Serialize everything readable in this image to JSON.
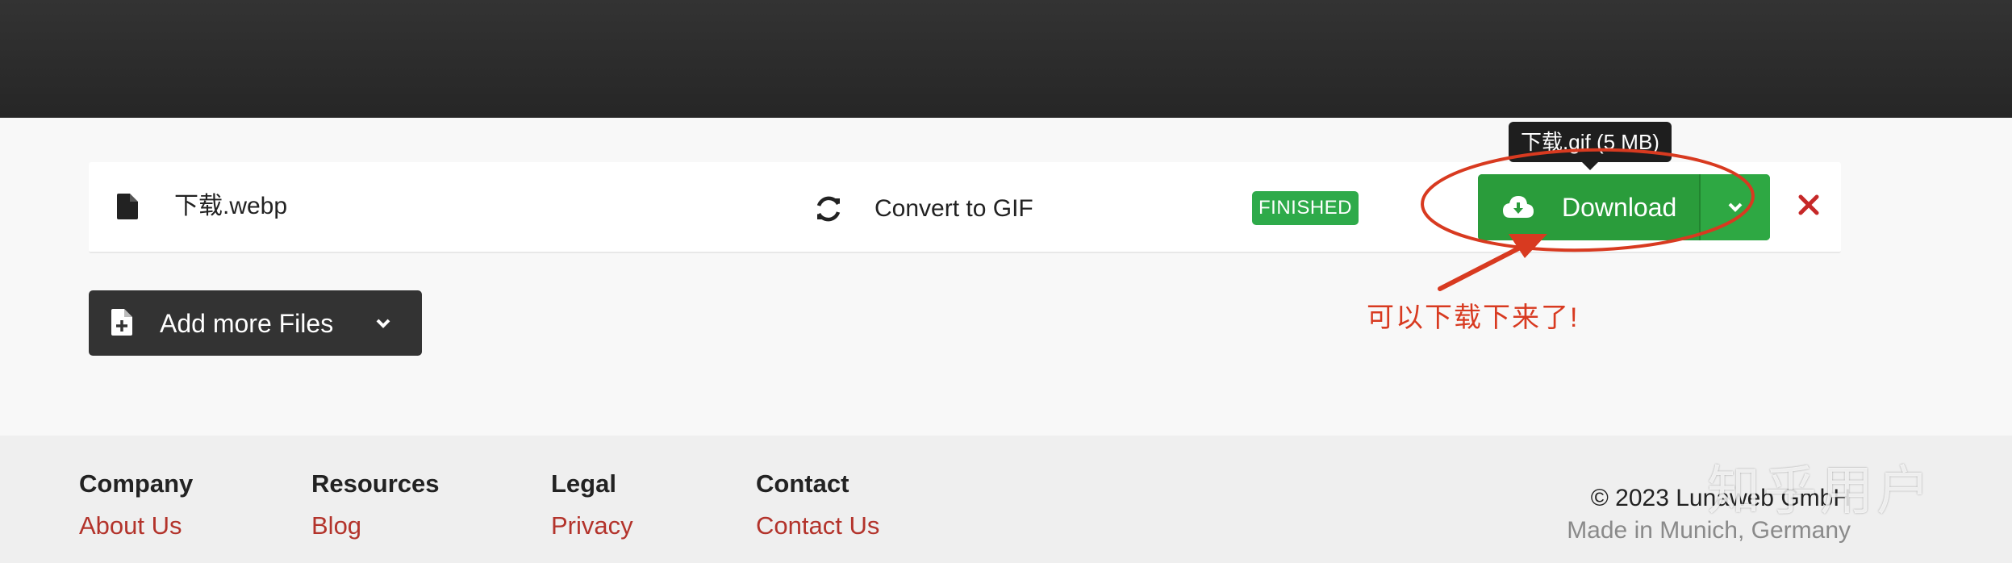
{
  "file_row": {
    "file_name": "下载.webp",
    "convert_label": "Convert to GIF",
    "status": "FINISHED",
    "download_label": "Download",
    "icons": [
      "file-icon",
      "convert-icon",
      "cloud-download-icon",
      "chevron-down-icon",
      "close-icon"
    ]
  },
  "tooltip": {
    "text": "下载.gif (5 MB)"
  },
  "annotation": {
    "text": "可以下载下来了!",
    "color": "#d83a20"
  },
  "add_files": {
    "label": "Add more Files",
    "icons": [
      "file-plus-icon",
      "chevron-down-icon"
    ]
  },
  "footer": {
    "columns": [
      {
        "heading": "Company",
        "link": "About Us"
      },
      {
        "heading": "Resources",
        "link": "Blog"
      },
      {
        "heading": "Legal",
        "link": "Privacy"
      },
      {
        "heading": "Contact",
        "link": "Contact Us"
      }
    ],
    "copyright": "© 2023 Lunaweb GmbH",
    "made_in": "Made in Munich, Germany",
    "watermark": "知乎用户"
  },
  "colors": {
    "accent_green": "#2a9c3b",
    "status_green": "#2eaa4a",
    "link_red": "#b3332b",
    "remove_red": "#c62828",
    "dark": "#333333"
  }
}
